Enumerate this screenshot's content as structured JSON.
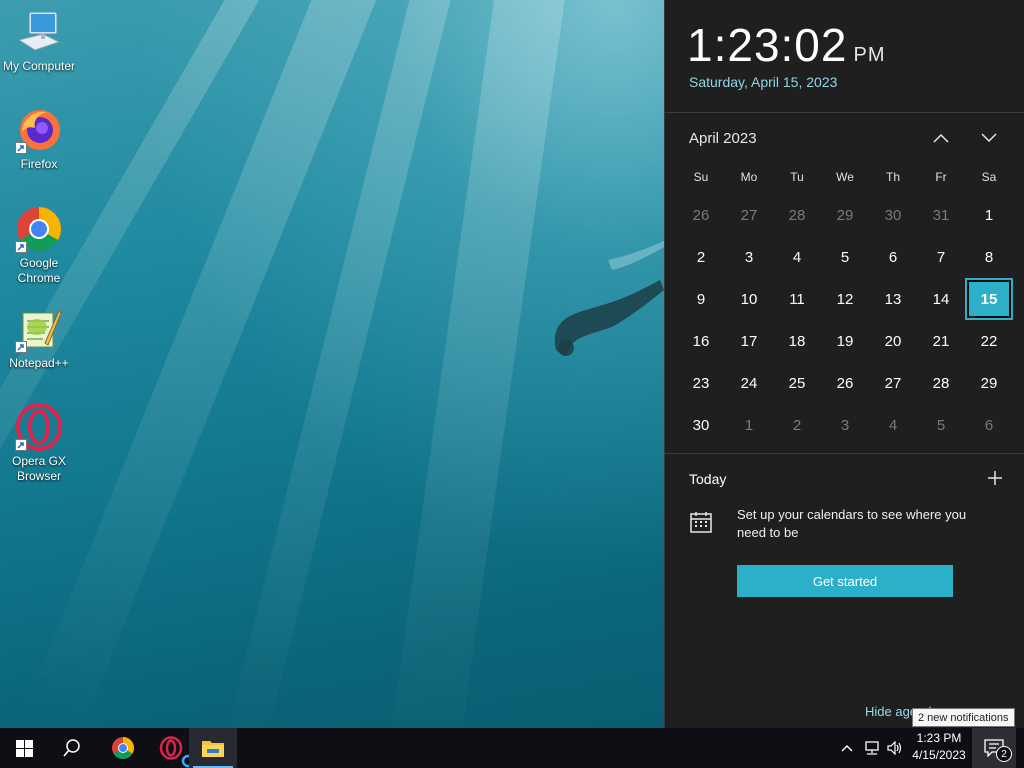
{
  "desktop": {
    "icons": [
      {
        "label": "My Computer",
        "icon": "computer-icon"
      },
      {
        "label": "Firefox",
        "icon": "firefox-icon"
      },
      {
        "label": "Google Chrome",
        "icon": "chrome-icon"
      },
      {
        "label": "Notepad++",
        "icon": "notepadpp-icon"
      },
      {
        "label": "Opera GX Browser",
        "icon": "opera-gx-icon"
      }
    ]
  },
  "flyout": {
    "clock": {
      "time": "1:23:02",
      "ampm": "PM"
    },
    "date_long": "Saturday, April 15, 2023",
    "calendar": {
      "month_title": "April 2023",
      "weekdays": [
        "Su",
        "Mo",
        "Tu",
        "We",
        "Th",
        "Fr",
        "Sa"
      ],
      "days": [
        {
          "d": "26",
          "m": "prev"
        },
        {
          "d": "27",
          "m": "prev"
        },
        {
          "d": "28",
          "m": "prev"
        },
        {
          "d": "29",
          "m": "prev"
        },
        {
          "d": "30",
          "m": "prev"
        },
        {
          "d": "31",
          "m": "prev"
        },
        {
          "d": "1",
          "m": "cur"
        },
        {
          "d": "2",
          "m": "cur"
        },
        {
          "d": "3",
          "m": "cur"
        },
        {
          "d": "4",
          "m": "cur"
        },
        {
          "d": "5",
          "m": "cur"
        },
        {
          "d": "6",
          "m": "cur"
        },
        {
          "d": "7",
          "m": "cur"
        },
        {
          "d": "8",
          "m": "cur"
        },
        {
          "d": "9",
          "m": "cur"
        },
        {
          "d": "10",
          "m": "cur"
        },
        {
          "d": "11",
          "m": "cur"
        },
        {
          "d": "12",
          "m": "cur"
        },
        {
          "d": "13",
          "m": "cur"
        },
        {
          "d": "14",
          "m": "cur"
        },
        {
          "d": "15",
          "m": "cur",
          "today": true
        },
        {
          "d": "16",
          "m": "cur"
        },
        {
          "d": "17",
          "m": "cur"
        },
        {
          "d": "18",
          "m": "cur"
        },
        {
          "d": "19",
          "m": "cur"
        },
        {
          "d": "20",
          "m": "cur"
        },
        {
          "d": "21",
          "m": "cur"
        },
        {
          "d": "22",
          "m": "cur"
        },
        {
          "d": "23",
          "m": "cur"
        },
        {
          "d": "24",
          "m": "cur"
        },
        {
          "d": "25",
          "m": "cur"
        },
        {
          "d": "26",
          "m": "cur"
        },
        {
          "d": "27",
          "m": "cur"
        },
        {
          "d": "28",
          "m": "cur"
        },
        {
          "d": "29",
          "m": "cur"
        },
        {
          "d": "30",
          "m": "cur"
        },
        {
          "d": "1",
          "m": "next"
        },
        {
          "d": "2",
          "m": "next"
        },
        {
          "d": "3",
          "m": "next"
        },
        {
          "d": "4",
          "m": "next"
        },
        {
          "d": "5",
          "m": "next"
        },
        {
          "d": "6",
          "m": "next"
        }
      ]
    },
    "agenda": {
      "today_label": "Today",
      "setup_text": "Set up your calendars to see where you need to be",
      "get_started_label": "Get started",
      "hide_agenda_label": "Hide agenda"
    }
  },
  "tooltip": {
    "text": "2 new notifications"
  },
  "taskbar": {
    "apps": [
      "start-icon",
      "search-icon",
      "chrome-icon",
      "opera-gx-icon",
      "file-explorer-icon"
    ],
    "tray": {
      "time": "1:23 PM",
      "date": "4/15/2023",
      "notification_count": "2"
    }
  },
  "colors": {
    "accent": "#2cb0c9",
    "flyout_bg": "#1f1f1f",
    "taskbar_bg": "#0d0f14",
    "date_text": "#8fd6e4"
  }
}
